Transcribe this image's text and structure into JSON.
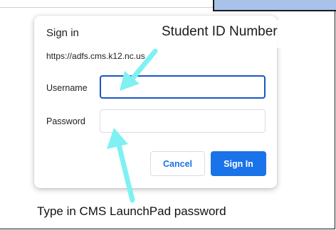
{
  "dialog": {
    "title": "Sign in",
    "url": "https://adfs.cms.k12.nc.us",
    "username_label": "Username",
    "username_value": "",
    "password_label": "Password",
    "password_value": "",
    "cancel_label": "Cancel",
    "signin_label": "Sign In"
  },
  "annotations": {
    "top_label": "Student ID Number",
    "bottom_label": "Type in CMS LaunchPad password"
  },
  "colors": {
    "primary": "#1a73e8",
    "focus_border": "#1a56c4",
    "arrow": "#7ff1f2",
    "highlight_block": "#a9c2ea"
  },
  "icons": [
    "arrow-to-username-icon",
    "arrow-to-password-icon"
  ]
}
